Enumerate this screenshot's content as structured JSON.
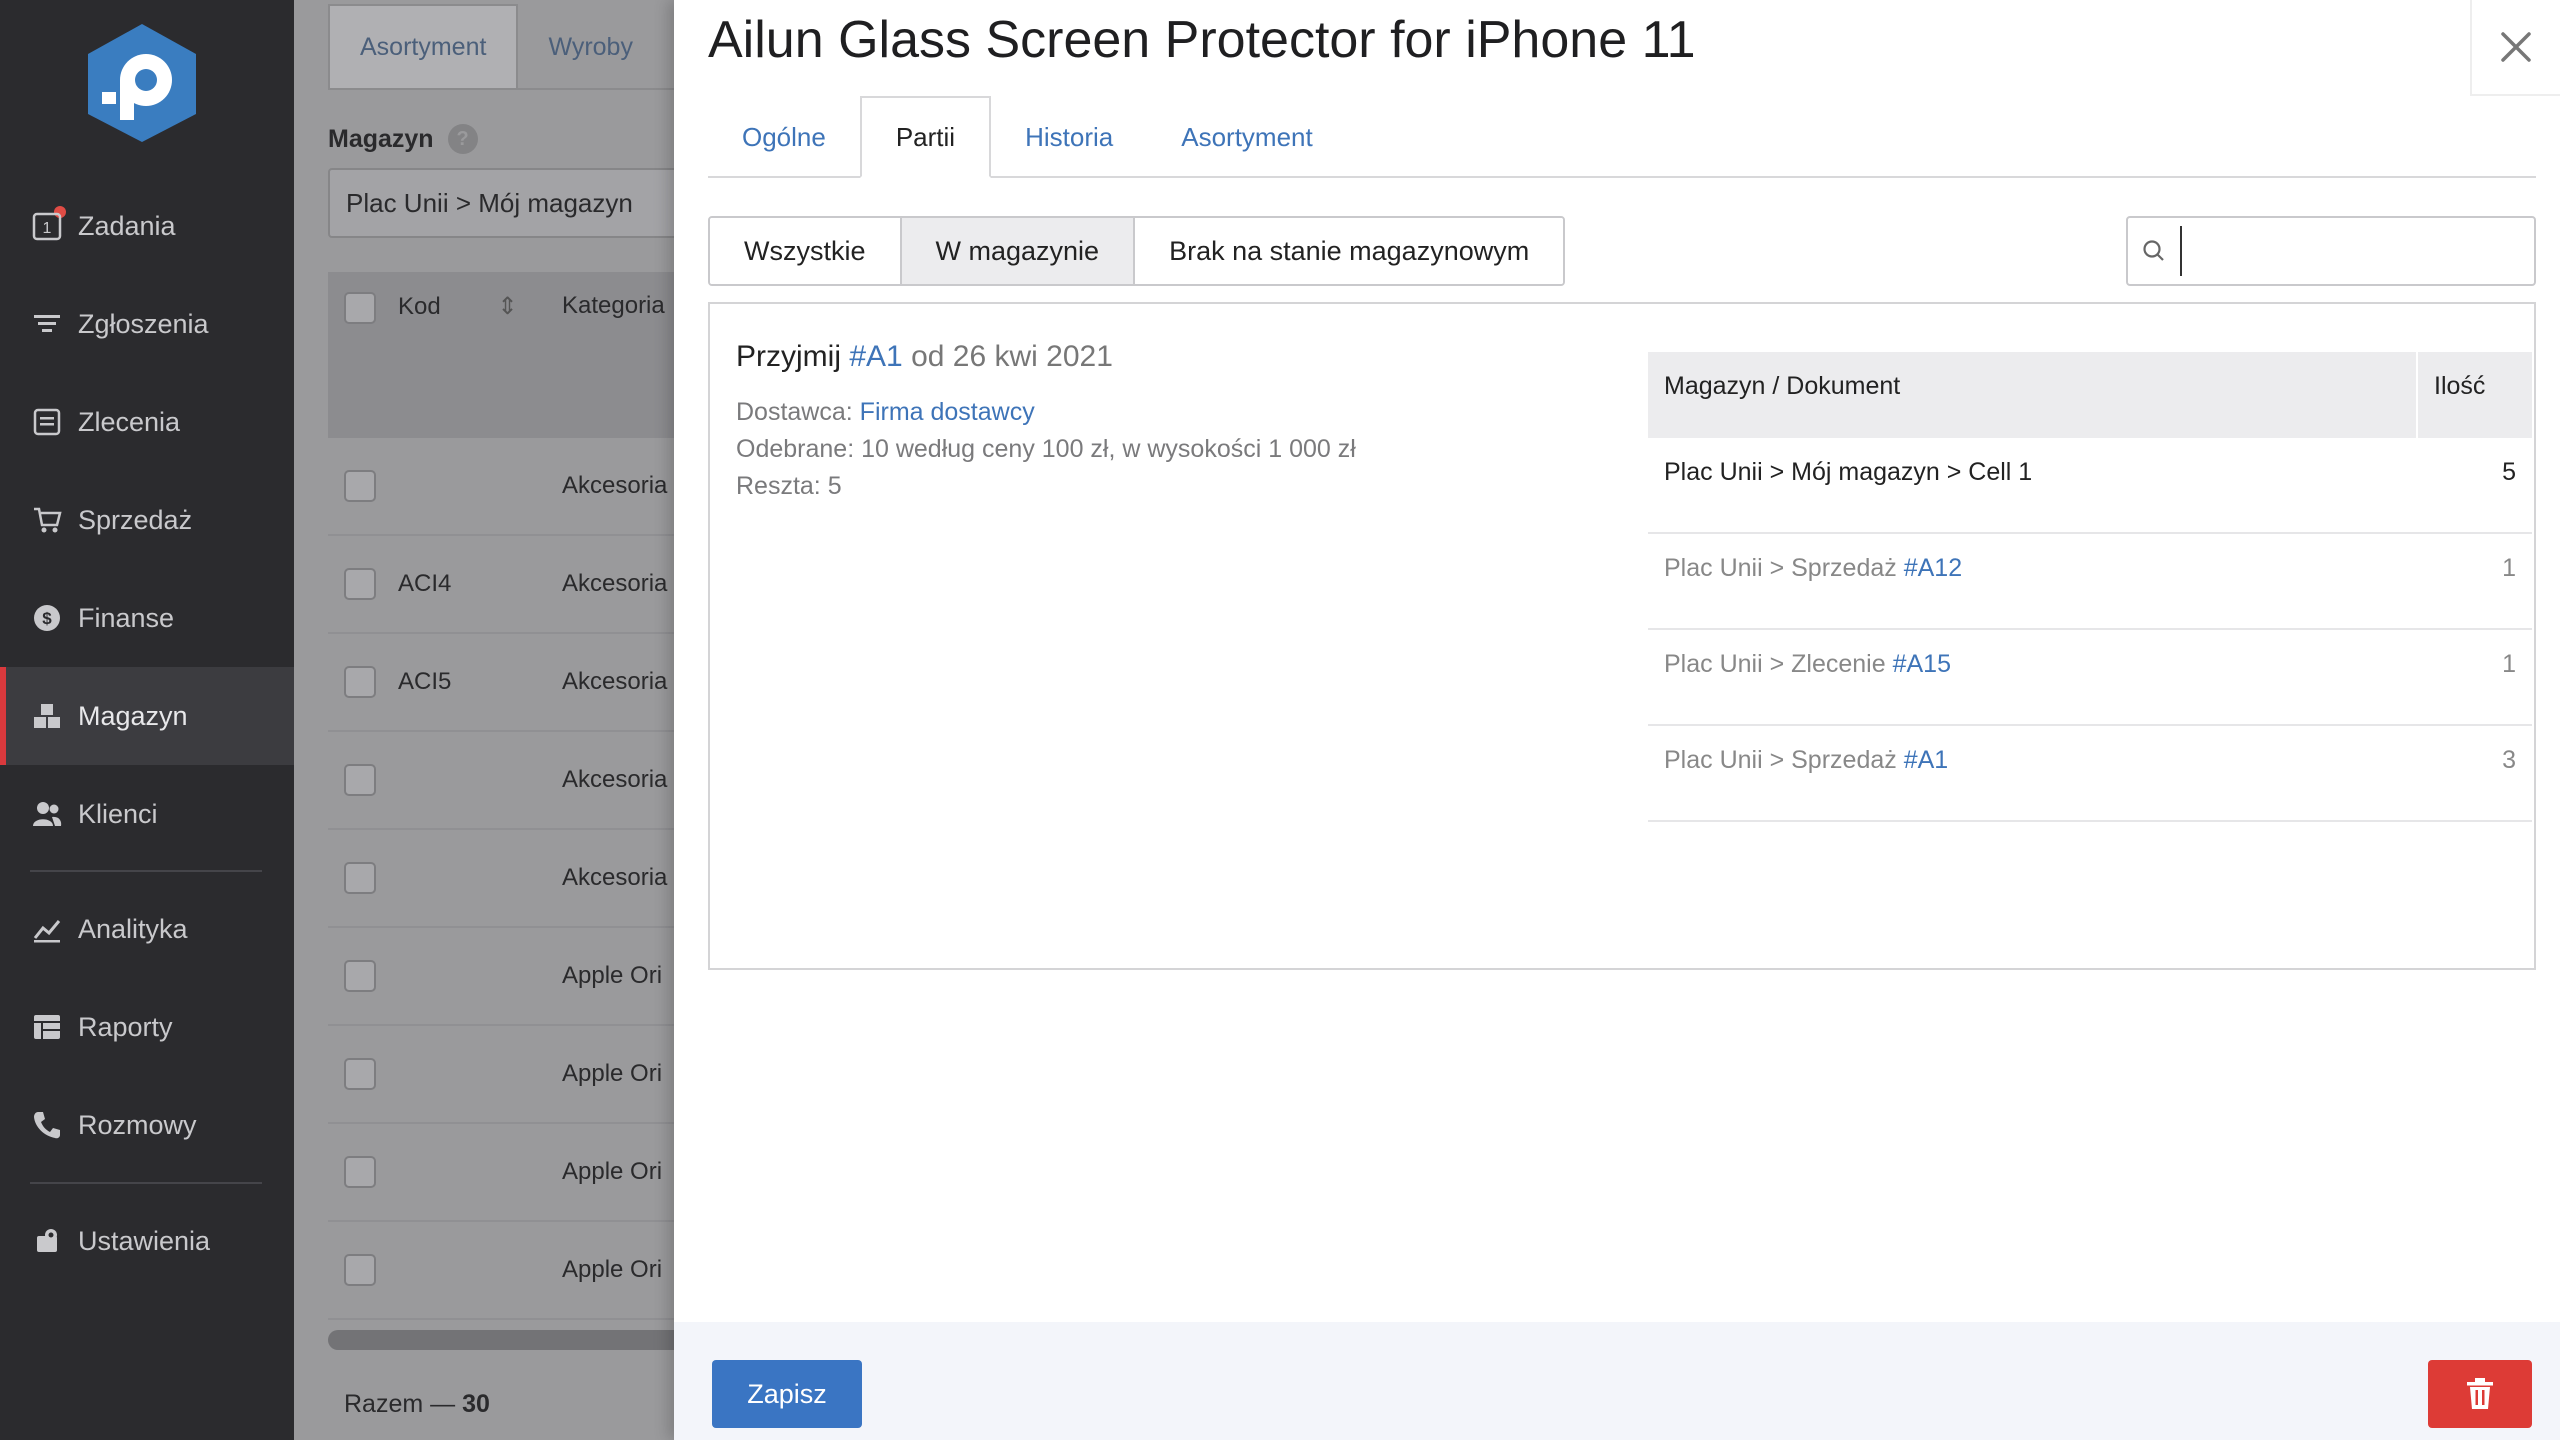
{
  "colors": {
    "sidebar_bg": "#2b2b2e",
    "accent": "#3a75c3",
    "danger": "#dd3b36",
    "link": "#3e74b8"
  },
  "sidebar": {
    "items": [
      {
        "label": "Zadania",
        "icon": "tasks-icon"
      },
      {
        "label": "Zgłoszenia",
        "icon": "filter-icon"
      },
      {
        "label": "Zlecenia",
        "icon": "orders-icon"
      },
      {
        "label": "Sprzedaż",
        "icon": "cart-icon"
      },
      {
        "label": "Finanse",
        "icon": "dollar-icon"
      },
      {
        "label": "Magazyn",
        "icon": "warehouse-icon"
      },
      {
        "label": "Klienci",
        "icon": "users-icon"
      },
      {
        "label": "Analityka",
        "icon": "chart-icon"
      },
      {
        "label": "Raporty",
        "icon": "reports-icon"
      },
      {
        "label": "Rozmowy",
        "icon": "phone-icon"
      },
      {
        "label": "Ustawienia",
        "icon": "settings-icon"
      }
    ]
  },
  "background": {
    "tabs": [
      "Asortyment",
      "Wyroby"
    ],
    "magazyn_label": "Magazyn",
    "magazyn_help": "?",
    "magazyn_value": "Plac Unii > Mój magazyn",
    "table_headers": {
      "kod": "Kod",
      "kategoria": "Kategoria"
    },
    "rows": [
      {
        "kod": "",
        "kategoria": "Akcesoria"
      },
      {
        "kod": "ACI4",
        "kategoria": "Akcesoria"
      },
      {
        "kod": "ACI5",
        "kategoria": "Akcesoria"
      },
      {
        "kod": "",
        "kategoria": "Akcesoria"
      },
      {
        "kod": "",
        "kategoria": "Akcesoria"
      },
      {
        "kod": "",
        "kategoria": "Apple Ori"
      },
      {
        "kod": "",
        "kategoria": "Apple Ori"
      },
      {
        "kod": "",
        "kategoria": "Apple Ori"
      },
      {
        "kod": "",
        "kategoria": "Apple Ori"
      }
    ],
    "total_label": "Razem —",
    "total_value": "30"
  },
  "modal": {
    "title": "Ailun Glass Screen Protector for iPhone 11",
    "tabs": [
      "Ogólne",
      "Partii",
      "Historia",
      "Asortyment"
    ],
    "filters": [
      "Wszystkie",
      "W magazynie",
      "Brak na stanie magazynowym"
    ],
    "search_placeholder": "",
    "batch": {
      "title_prefix": "Przyjmij",
      "title_link": "#A1",
      "title_suffix": "od 26 kwi 2021",
      "supplier_label": "Dostawca:",
      "supplier_link": "Firma dostawcy",
      "received": "Odebrane: 10 według ceny 100 zł, w wysokości 1 000 zł",
      "remaining": "Reszta: 5"
    },
    "stock_table": {
      "headers": {
        "location": "Magazyn / Dokument",
        "qty": "Ilość"
      },
      "rows": [
        {
          "location": "Plac Unii > Mój magazyn > Cell 1",
          "link": "",
          "qty": "5"
        },
        {
          "location": "Plac Unii > Sprzedaż",
          "link": "#A12",
          "qty": "1"
        },
        {
          "location": "Plac Unii > Zlecenie",
          "link": "#A15",
          "qty": "1"
        },
        {
          "location": "Plac Unii > Sprzedaż",
          "link": "#A1",
          "qty": "3"
        }
      ]
    },
    "save_label": "Zapisz"
  }
}
